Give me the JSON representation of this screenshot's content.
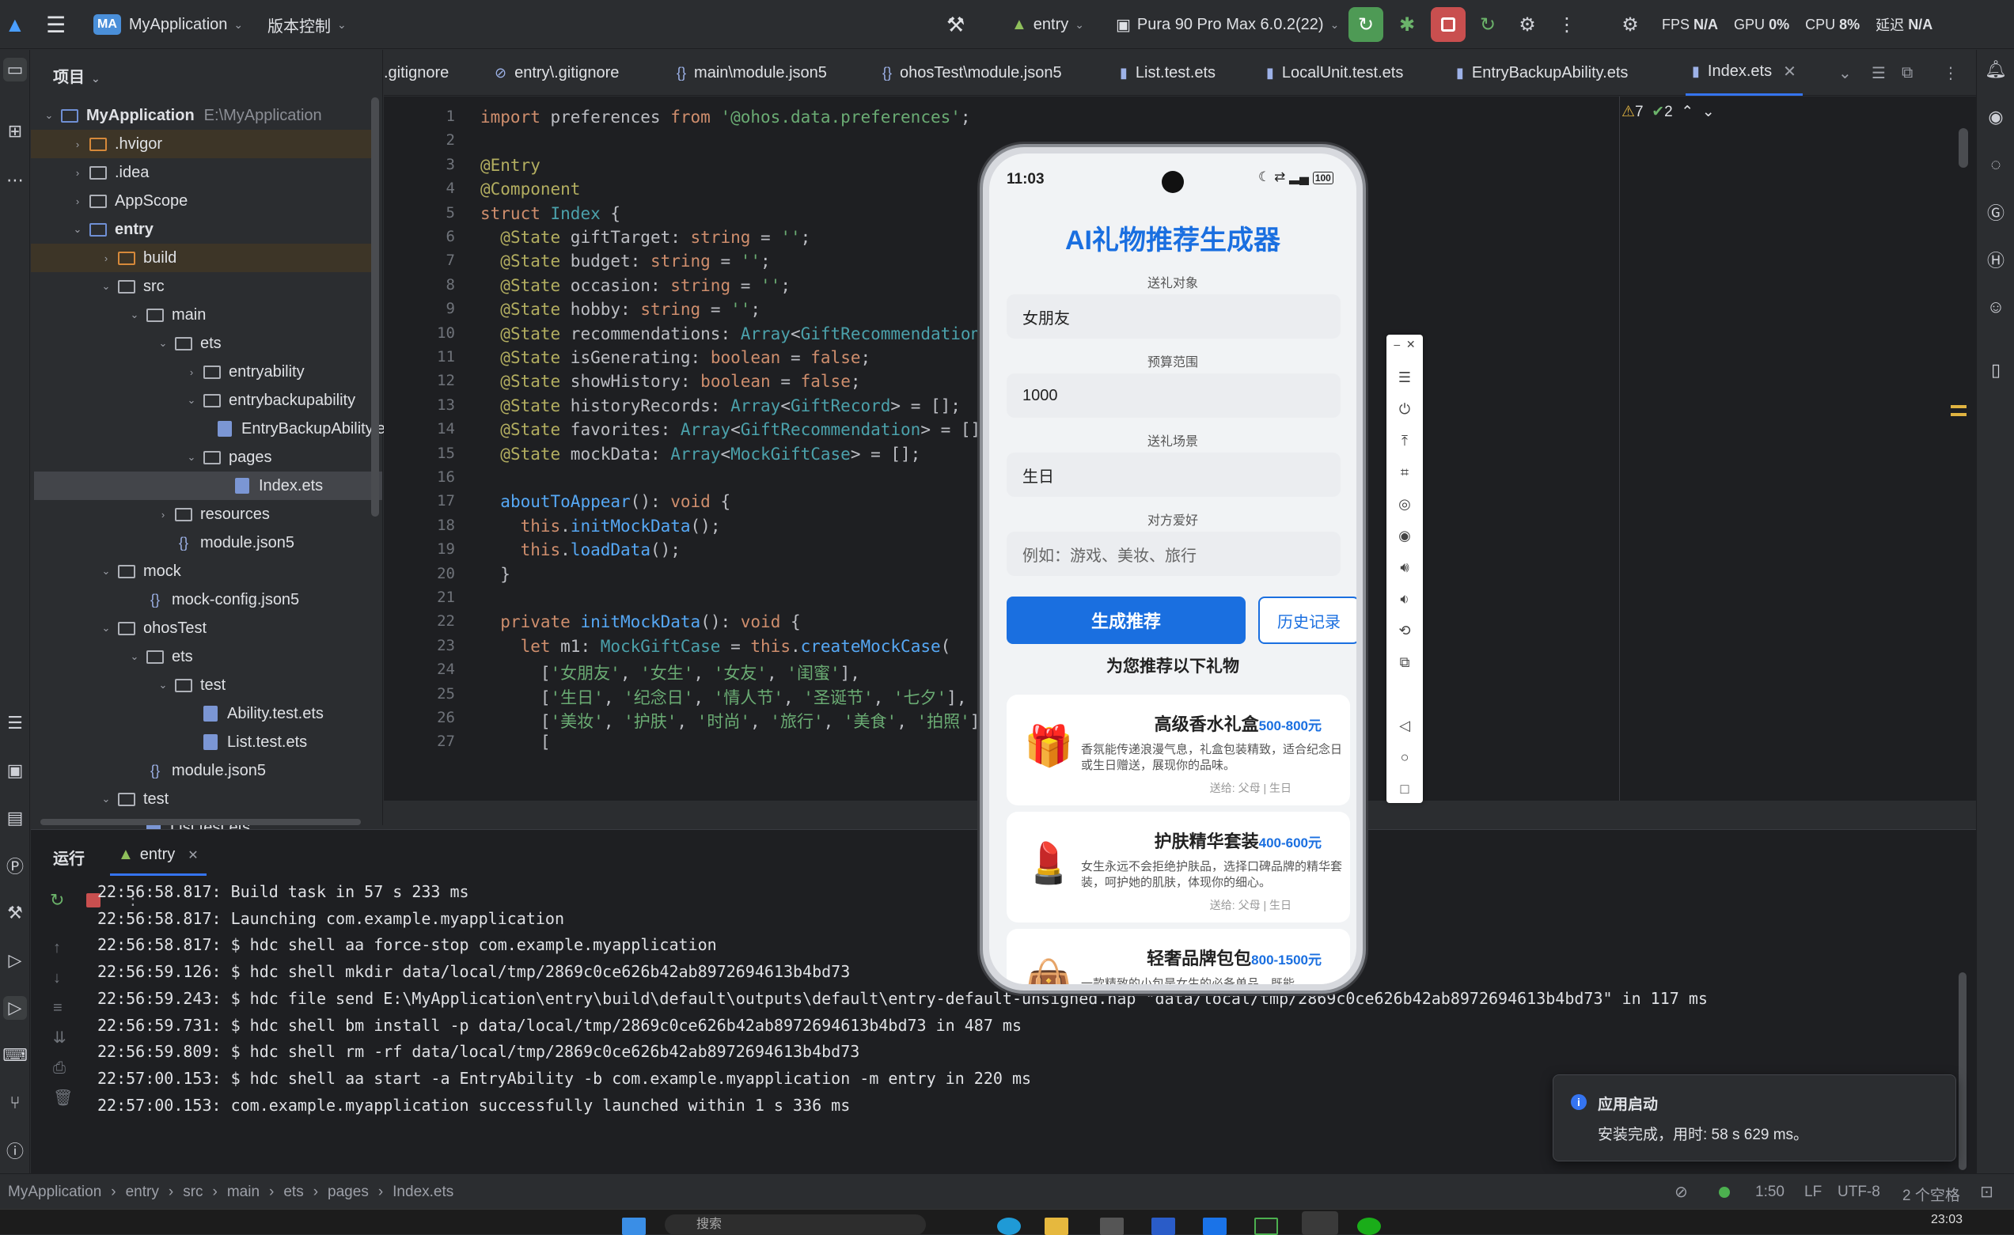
{
  "titlebar": {
    "project_badge": "MA",
    "project_name": "MyApplication",
    "vcs": "版本控制",
    "run_config": "entry",
    "device": "Pura 90 Pro Max 6.0.2(22)",
    "fps_label": "FPS",
    "fps_val": "N/A",
    "gpu_label": "GPU",
    "gpu_val": "0%",
    "cpu_label": "CPU",
    "cpu_val": "8%",
    "latency_label": "延迟",
    "latency_val": "N/A"
  },
  "project": {
    "header": "项目",
    "items": [
      {
        "label": "MyApplication",
        "extra": "E:\\MyApplication",
        "arrow": "v",
        "bold": true
      },
      {
        "label": ".hvigor",
        "arrow": ">"
      },
      {
        "label": ".idea",
        "arrow": ">"
      },
      {
        "label": "AppScope",
        "arrow": ">"
      },
      {
        "label": "entry",
        "arrow": "v",
        "bold": true
      },
      {
        "label": "build",
        "arrow": ">"
      },
      {
        "label": "src",
        "arrow": "v"
      },
      {
        "label": "main",
        "arrow": "v"
      },
      {
        "label": "ets",
        "arrow": "v"
      },
      {
        "label": "entryability",
        "arrow": ">"
      },
      {
        "label": "entrybackupability",
        "arrow": "v"
      },
      {
        "label": "EntryBackupAbility.ets",
        "arrow": ""
      },
      {
        "label": "pages",
        "arrow": "v"
      },
      {
        "label": "Index.ets",
        "arrow": ""
      },
      {
        "label": "resources",
        "arrow": ">"
      },
      {
        "label": "module.json5",
        "arrow": ""
      },
      {
        "label": "mock",
        "arrow": "v"
      },
      {
        "label": "mock-config.json5",
        "arrow": ""
      },
      {
        "label": "ohosTest",
        "arrow": "v"
      },
      {
        "label": "ets",
        "arrow": "v"
      },
      {
        "label": "test",
        "arrow": "v"
      },
      {
        "label": "Ability.test.ets",
        "arrow": ""
      },
      {
        "label": "List.test.ets",
        "arrow": ""
      },
      {
        "label": "module.json5",
        "arrow": ""
      },
      {
        "label": "test",
        "arrow": "v"
      },
      {
        "label": "List.test.ets",
        "arrow": ""
      }
    ]
  },
  "tabs": [
    ".gitignore",
    "entry\\.gitignore",
    "main\\module.json5",
    "ohosTest\\module.json5",
    "List.test.ets",
    "LocalUnit.test.ets",
    "EntryBackupAbility.ets",
    "Index.ets"
  ],
  "editor": {
    "warnings": "7",
    "checks": "2",
    "lines": [
      "import preferences from '@ohos.data.preferences';",
      "",
      "@Entry",
      "@Component",
      "struct Index {",
      "  @State giftTarget: string = '';",
      "  @State budget: string = '';",
      "  @State occasion: string = '';",
      "  @State hobby: string = '';",
      "  @State recommendations: Array<GiftRecommendation> =",
      "  @State isGenerating: boolean = false;",
      "  @State showHistory: boolean = false;",
      "  @State historyRecords: Array<GiftRecord> = [];",
      "  @State favorites: Array<GiftRecommendation> = [];",
      "  @State mockData: Array<MockGiftCase> = [];",
      "",
      "  aboutToAppear(): void {",
      "    this.initMockData();",
      "    this.loadData();",
      "  }",
      "",
      "  private initMockData(): void {",
      "    let m1: MockGiftCase = this.createMockCase(",
      "      ['女朋友', '女生', '女友', '闺蜜'],",
      "      ['生日', '纪念日', '情人节', '圣诞节', '七夕'],",
      "      ['美妆', '护肤', '时尚', '旅行', '美食', '拍照'],",
      "      ["
    ]
  },
  "run": {
    "tab_run": "运行",
    "tab_entry": "entry",
    "lines": [
      "22:56:58.817: Build task in 57 s 233 ms",
      "22:56:58.817: Launching com.example.myapplication",
      "22:56:58.817: $ hdc shell aa force-stop com.example.myapplication",
      "22:56:59.126: $ hdc shell mkdir data/local/tmp/2869c0ce626b42ab8972694613b4bd73",
      "22:56:59.243: $ hdc file send E:\\MyApplication\\entry\\build\\default\\outputs\\default\\entry-default-unsigned.hap \"data/local/tmp/2869c0ce626b42ab8972694613b4bd73\" in 117 ms",
      "22:56:59.731: $ hdc shell bm install -p data/local/tmp/2869c0ce626b42ab8972694613b4bd73 in 487 ms",
      "22:56:59.809: $ hdc shell rm -rf data/local/tmp/2869c0ce626b42ab8972694613b4bd73",
      "22:57:00.153: $ hdc shell aa start -a EntryAbility -b com.example.myapplication -m entry in 220 ms",
      "22:57:00.153: com.example.myapplication successfully launched within 1 s 336 ms"
    ]
  },
  "phone": {
    "time": "11:03",
    "battery": "100",
    "title": "AI礼物推荐生成器",
    "labels": {
      "target": "送礼对象",
      "budget": "预算范围",
      "occasion": "送礼场景",
      "hobby": "对方爱好"
    },
    "values": {
      "target": "女朋友",
      "budget": "1000",
      "occasion": "生日"
    },
    "hobby_placeholder": "例如：游戏、美妆、旅行",
    "btn_generate": "生成推荐",
    "btn_history": "历史记录",
    "section": "为您推荐以下礼物",
    "cards": [
      {
        "name": "高级香水礼盒",
        "price": "500-800元",
        "desc": "香氛能传递浪漫气息，礼盒包装精致，适合纪念日或生日赠送，展现你的品味。",
        "meta": "送给: 父母 | 生日",
        "icon": "🎁"
      },
      {
        "name": "护肤精华套装",
        "price": "400-600元",
        "desc": "女生永远不会拒绝护肤品，选择口碑品牌的精华套装，呵护她的肌肤，体现你的细心。",
        "meta": "送给: 父母 | 生日",
        "icon": "💄"
      },
      {
        "name": "轻奢品牌包包",
        "price": "800-1500元",
        "desc": "一款精致的小包是女生的必备单品，既能",
        "meta": "",
        "icon": "👜"
      }
    ]
  },
  "statusbar": {
    "crumbs": [
      "MyApplication",
      "entry",
      "src",
      "main",
      "ets",
      "pages",
      "Index.ets"
    ],
    "pos": "1:50",
    "eol": "LF",
    "enc": "UTF-8",
    "indent": "2 个空格"
  },
  "toast": {
    "title": "应用启动",
    "body": "安装完成，用时: 58 s 629 ms。"
  },
  "taskbar": {
    "search": "搜索",
    "time": "23:03"
  },
  "colors": {
    "accent": "#1a6fe0",
    "bg": "#2b2d30",
    "editor": "#1e1f22",
    "stop_red": "#c94f4f",
    "run_green": "#4e9a55"
  }
}
